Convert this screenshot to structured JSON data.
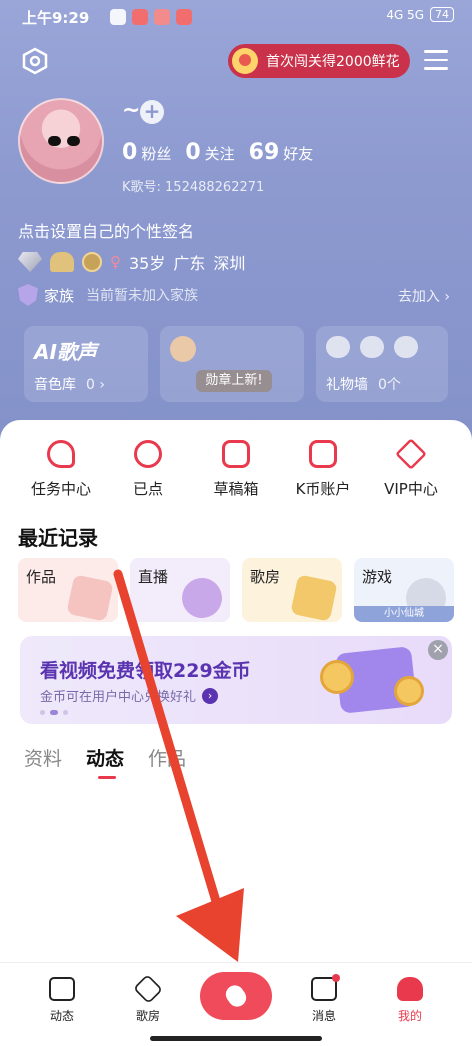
{
  "status_bar": {
    "time": "上午9:29",
    "network": "4G 5G",
    "battery": "74"
  },
  "header": {
    "promo": "首次闯关得2000鲜花"
  },
  "profile": {
    "nickname": "~",
    "fans_count": "0",
    "fans_label": "粉丝",
    "following_count": "0",
    "following_label": "关注",
    "friends_count": "69",
    "friends_label": "好友",
    "k_id": "K歌号: 152488262271",
    "signature": "点击设置自己的个性签名",
    "age": "35岁",
    "province": "广东",
    "city": "深圳",
    "family_label": "家族",
    "family_status": "当前暂未加入家族",
    "join_label": "去加入 ›"
  },
  "cards": {
    "ai_logo": "AI歌声",
    "voice_label": "音色库",
    "voice_count": "0 ›",
    "medal_tag": "勋章上新!",
    "gift_label": "礼物墙",
    "gift_count": "0个"
  },
  "quick_actions": [
    "任务中心",
    "已点",
    "草稿箱",
    "K币账户",
    "VIP中心"
  ],
  "recent": {
    "title": "最近记录",
    "items": [
      "作品",
      "直播",
      "歌房",
      "游戏"
    ],
    "game_tag": "小小仙城"
  },
  "banner": {
    "headline": "看视频免费领取229金币",
    "sub": "金币可在用户中心兑换好礼"
  },
  "tabs": [
    "资料",
    "动态",
    "作品"
  ],
  "nav": [
    "动态",
    "歌房",
    "消息",
    "我的"
  ],
  "colors": {
    "accent": "#e8394d",
    "header_bg": "#9aa6d8",
    "banner_text": "#5a34b0"
  }
}
